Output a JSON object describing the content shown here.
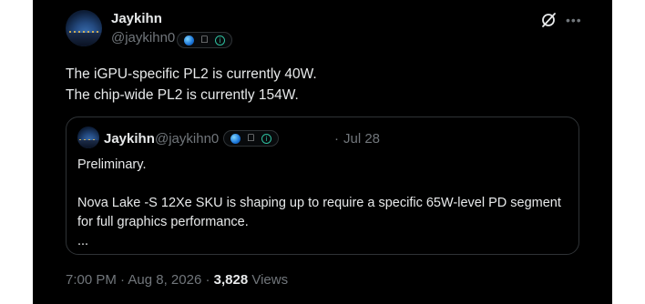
{
  "author": {
    "display_name": "Jaykihn",
    "handle": "@jaykihn0",
    "badges": [
      "globe-icon",
      "apple-icon",
      "info-icon"
    ]
  },
  "post": {
    "lines": [
      "The iGPU-specific PL2 is currently 40W.",
      "The chip-wide PL2 is currently 154W."
    ]
  },
  "quoted": {
    "display_name": "Jaykihn",
    "handle": "@jaykihn0",
    "separator": "·",
    "date": "Jul 28",
    "paragraph_1": "Preliminary.",
    "paragraph_2_line_1": "Nova Lake -S 12Xe SKU is shaping up to require a specific 65W-level PD segment",
    "paragraph_2_line_2": "for full graphics performance.",
    "paragraph_3": "..."
  },
  "meta": {
    "time": "7:00 PM",
    "separator_1": "·",
    "date": "Aug 8, 2026",
    "separator_2": "·",
    "views_count": "3,828",
    "views_label": "Views"
  },
  "colors": {
    "background": "#000000",
    "text_primary": "#e7e9ea",
    "text_secondary": "#71767b",
    "border": "#2f3336"
  }
}
